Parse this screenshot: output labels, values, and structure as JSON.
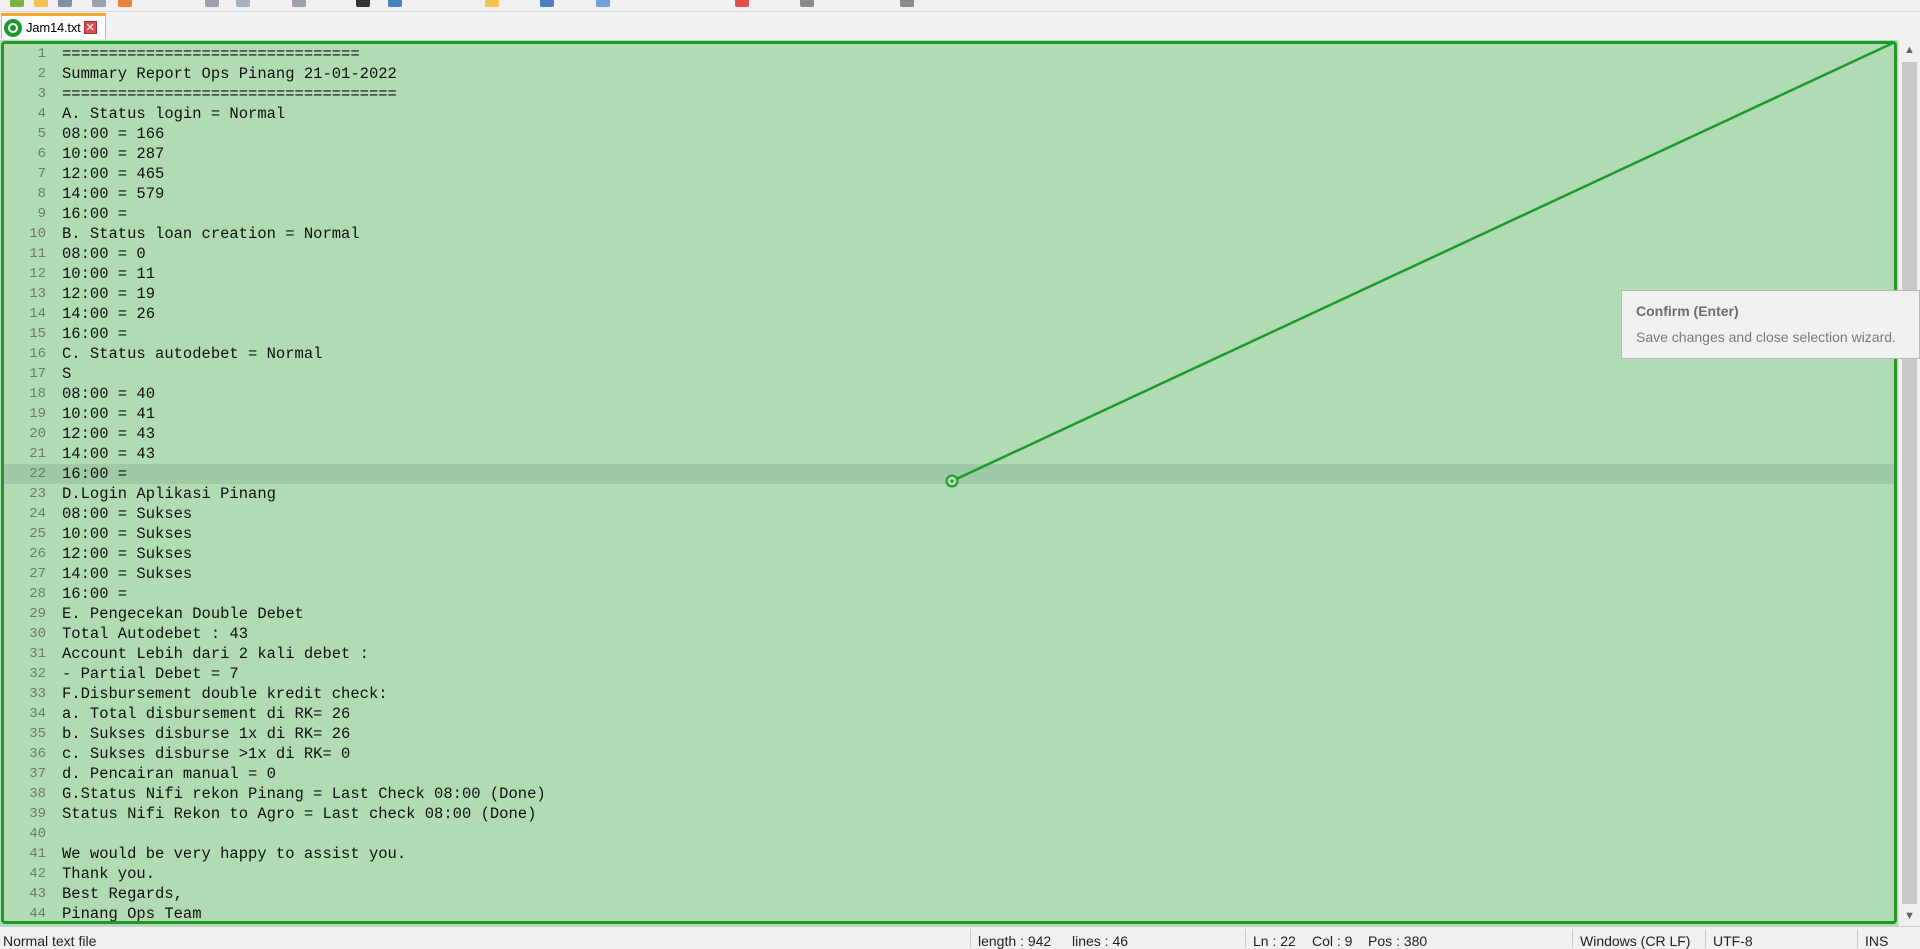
{
  "tab": {
    "label": "Jam14.txt"
  },
  "editor": {
    "line_numbers": [
      "1",
      "2",
      "3",
      "4",
      "5",
      "6",
      "7",
      "8",
      "9",
      "10",
      "11",
      "12",
      "13",
      "14",
      "15",
      "16",
      "17",
      "18",
      "19",
      "20",
      "21",
      "22",
      "23",
      "24",
      "25",
      "26",
      "27",
      "28",
      "29",
      "30",
      "31",
      "32",
      "33",
      "34",
      "35",
      "36",
      "37",
      "38",
      "39",
      "40",
      "41",
      "42",
      "43",
      "44"
    ],
    "lines": [
      "================================",
      "Summary Report Ops Pinang 21-01-2022",
      "====================================",
      "A. Status login = Normal",
      "08:00 = 166",
      "10:00 = 287",
      "12:00 = 465",
      "14:00 = 579",
      "16:00 =",
      "B. Status loan creation = Normal",
      "08:00 = 0",
      "10:00 = 11",
      "12:00 = 19",
      "14:00 = 26",
      "16:00 =",
      "C. Status autodebet = Normal",
      "S",
      "08:00 = 40",
      "10:00 = 41",
      "12:00 = 43",
      "14:00 = 43",
      "16:00 =",
      "D.Login Aplikasi Pinang",
      "08:00 = Sukses",
      "10:00 = Sukses",
      "12:00 = Sukses",
      "14:00 = Sukses",
      "16:00 =",
      "E. Pengecekan Double Debet",
      "Total Autodebet : 43",
      "Account Lebih dari 2 kali debet :",
      "- Partial Debet = 7",
      "F.Disbursement double kredit check:",
      "a. Total disbursement di RK= 26",
      "b. Sukses disburse 1x di RK= 26",
      "c. Sukses disburse >1x di RK= 0",
      "d. Pencairan manual = 0",
      "G.Status Nifi rekon Pinang = Last Check 08:00 (Done)",
      "Status Nifi Rekon to Agro = Last check 08:00 (Done)",
      "",
      "We would be very happy to assist you.",
      "Thank you.",
      "Best Regards,",
      "Pinang Ops Team"
    ],
    "current_line": 22
  },
  "tooltip": {
    "title": "Confirm (Enter)",
    "body": "Save changes and close selection wizard."
  },
  "statusbar": {
    "file_type": "Normal text file",
    "length": "length : 942",
    "lines": "lines : 46",
    "ln": "Ln : 22",
    "col": "Col : 9",
    "pos": "Pos : 380",
    "eol": "Windows (CR LF)",
    "encoding": "UTF-8",
    "mode": "INS"
  },
  "colors": {
    "editor_background": "#b1dcb3",
    "selection_border": "#1e9a2a",
    "current_line": "#9fc9a7",
    "tab_accent": "#f5a623"
  },
  "icons": [
    "selection-wizard-icon",
    "tab-close-icon",
    "scroll-up-icon",
    "scroll-down-icon",
    "selection-handle-icon"
  ]
}
